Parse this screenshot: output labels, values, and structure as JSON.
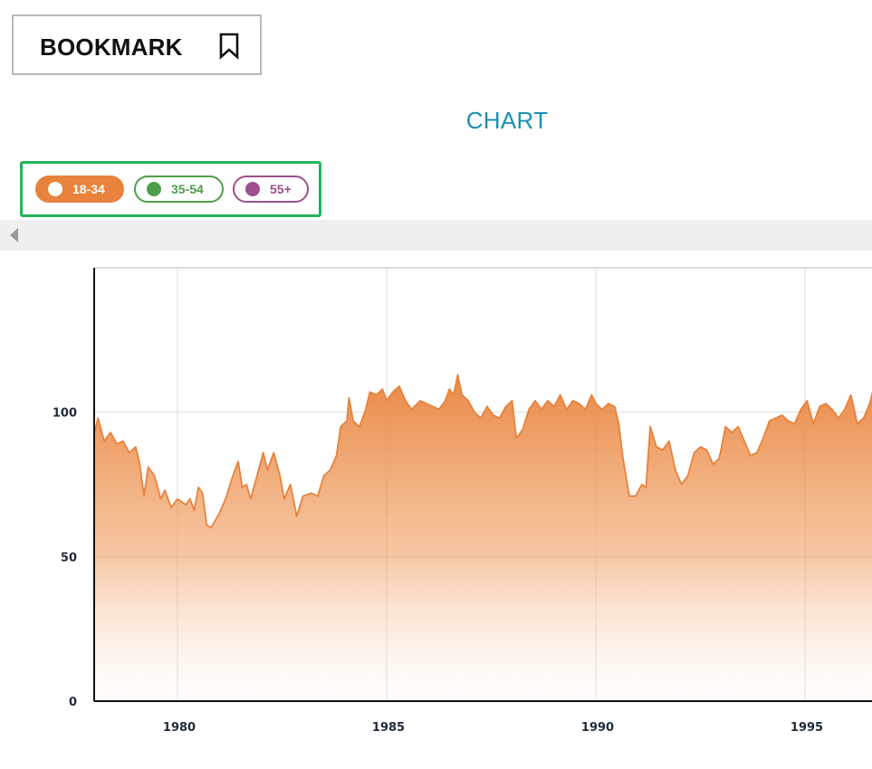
{
  "bookmark": {
    "label": "BOOKMARK",
    "icon": "bookmark-icon"
  },
  "legend": [
    {
      "label": "18-34",
      "color": "#e8823c",
      "active": true
    },
    {
      "label": "35-54",
      "color": "#4d9e4b",
      "active": false
    },
    {
      "label": "55+",
      "color": "#9c4f8c",
      "active": false
    }
  ],
  "scroll": {
    "icon": "chevron-left-icon"
  },
  "chart_data": {
    "type": "area",
    "title": "CHART",
    "xlabel": "",
    "ylabel": "",
    "xlim": [
      1978.0,
      1996.7
    ],
    "ylim": [
      0,
      150
    ],
    "grid": true,
    "y_ticks": [
      0,
      50,
      100
    ],
    "x_ticks": [
      1980,
      1985,
      1990,
      1995
    ],
    "series": [
      {
        "name": "18-34",
        "color": "#e8823c",
        "points": [
          [
            1978.0,
            92
          ],
          [
            1978.1,
            98
          ],
          [
            1978.25,
            90
          ],
          [
            1978.4,
            93
          ],
          [
            1978.55,
            89
          ],
          [
            1978.7,
            90
          ],
          [
            1978.85,
            86
          ],
          [
            1979.0,
            88
          ],
          [
            1979.1,
            82
          ],
          [
            1979.2,
            71
          ],
          [
            1979.3,
            81
          ],
          [
            1979.45,
            78
          ],
          [
            1979.6,
            70
          ],
          [
            1979.7,
            73
          ],
          [
            1979.85,
            67
          ],
          [
            1980.0,
            70
          ],
          [
            1980.2,
            68
          ],
          [
            1980.3,
            70
          ],
          [
            1980.4,
            66
          ],
          [
            1980.5,
            74
          ],
          [
            1980.6,
            72
          ],
          [
            1980.7,
            61
          ],
          [
            1980.8,
            60
          ],
          [
            1981.0,
            65
          ],
          [
            1981.15,
            70
          ],
          [
            1981.3,
            77
          ],
          [
            1981.45,
            83
          ],
          [
            1981.55,
            74
          ],
          [
            1981.65,
            75
          ],
          [
            1981.75,
            70
          ],
          [
            1981.9,
            78
          ],
          [
            1982.05,
            86
          ],
          [
            1982.15,
            80
          ],
          [
            1982.3,
            86
          ],
          [
            1982.45,
            78
          ],
          [
            1982.55,
            70
          ],
          [
            1982.7,
            75
          ],
          [
            1982.85,
            64
          ],
          [
            1983.0,
            71
          ],
          [
            1983.2,
            72
          ],
          [
            1983.35,
            71
          ],
          [
            1983.5,
            78
          ],
          [
            1983.65,
            80
          ],
          [
            1983.8,
            85
          ],
          [
            1983.9,
            95
          ],
          [
            1984.05,
            97
          ],
          [
            1984.1,
            105
          ],
          [
            1984.2,
            97
          ],
          [
            1984.35,
            95
          ],
          [
            1984.5,
            101
          ],
          [
            1984.6,
            107
          ],
          [
            1984.75,
            106
          ],
          [
            1984.9,
            108
          ],
          [
            1985.0,
            104
          ],
          [
            1985.15,
            107
          ],
          [
            1985.3,
            109
          ],
          [
            1985.45,
            104
          ],
          [
            1985.6,
            101
          ],
          [
            1985.8,
            104
          ],
          [
            1985.95,
            103
          ],
          [
            1986.1,
            102
          ],
          [
            1986.25,
            101
          ],
          [
            1986.4,
            104
          ],
          [
            1986.5,
            108
          ],
          [
            1986.6,
            106
          ],
          [
            1986.7,
            113
          ],
          [
            1986.8,
            106
          ],
          [
            1986.95,
            104
          ],
          [
            1987.1,
            100
          ],
          [
            1987.25,
            98
          ],
          [
            1987.4,
            102
          ],
          [
            1987.55,
            99
          ],
          [
            1987.7,
            98
          ],
          [
            1987.85,
            102
          ],
          [
            1988.0,
            104
          ],
          [
            1988.1,
            91
          ],
          [
            1988.25,
            94
          ],
          [
            1988.4,
            101
          ],
          [
            1988.55,
            104
          ],
          [
            1988.7,
            101
          ],
          [
            1988.85,
            104
          ],
          [
            1989.0,
            102
          ],
          [
            1989.15,
            106
          ],
          [
            1989.3,
            101
          ],
          [
            1989.45,
            104
          ],
          [
            1989.6,
            103
          ],
          [
            1989.75,
            101
          ],
          [
            1989.9,
            106
          ],
          [
            1990.0,
            103
          ],
          [
            1990.15,
            101
          ],
          [
            1990.3,
            103
          ],
          [
            1990.45,
            102
          ],
          [
            1990.55,
            96
          ],
          [
            1990.65,
            84
          ],
          [
            1990.8,
            71
          ],
          [
            1990.95,
            71
          ],
          [
            1991.1,
            75
          ],
          [
            1991.2,
            74
          ],
          [
            1991.3,
            95
          ],
          [
            1991.45,
            88
          ],
          [
            1991.6,
            87
          ],
          [
            1991.75,
            90
          ],
          [
            1991.9,
            80
          ],
          [
            1992.05,
            75
          ],
          [
            1992.2,
            78
          ],
          [
            1992.35,
            86
          ],
          [
            1992.5,
            88
          ],
          [
            1992.65,
            87
          ],
          [
            1992.8,
            82
          ],
          [
            1992.95,
            84
          ],
          [
            1993.1,
            95
          ],
          [
            1993.25,
            93
          ],
          [
            1993.4,
            95
          ],
          [
            1993.55,
            90
          ],
          [
            1993.7,
            85
          ],
          [
            1993.85,
            86
          ],
          [
            1994.0,
            91
          ],
          [
            1994.15,
            97
          ],
          [
            1994.3,
            98
          ],
          [
            1994.45,
            99
          ],
          [
            1994.6,
            97
          ],
          [
            1994.75,
            96
          ],
          [
            1994.9,
            101
          ],
          [
            1995.05,
            104
          ],
          [
            1995.2,
            96
          ],
          [
            1995.35,
            102
          ],
          [
            1995.5,
            103
          ],
          [
            1995.65,
            101
          ],
          [
            1995.8,
            98
          ],
          [
            1995.95,
            101
          ],
          [
            1996.1,
            106
          ],
          [
            1996.25,
            96
          ],
          [
            1996.4,
            98
          ],
          [
            1996.55,
            103
          ],
          [
            1996.7,
            112
          ]
        ]
      }
    ]
  }
}
